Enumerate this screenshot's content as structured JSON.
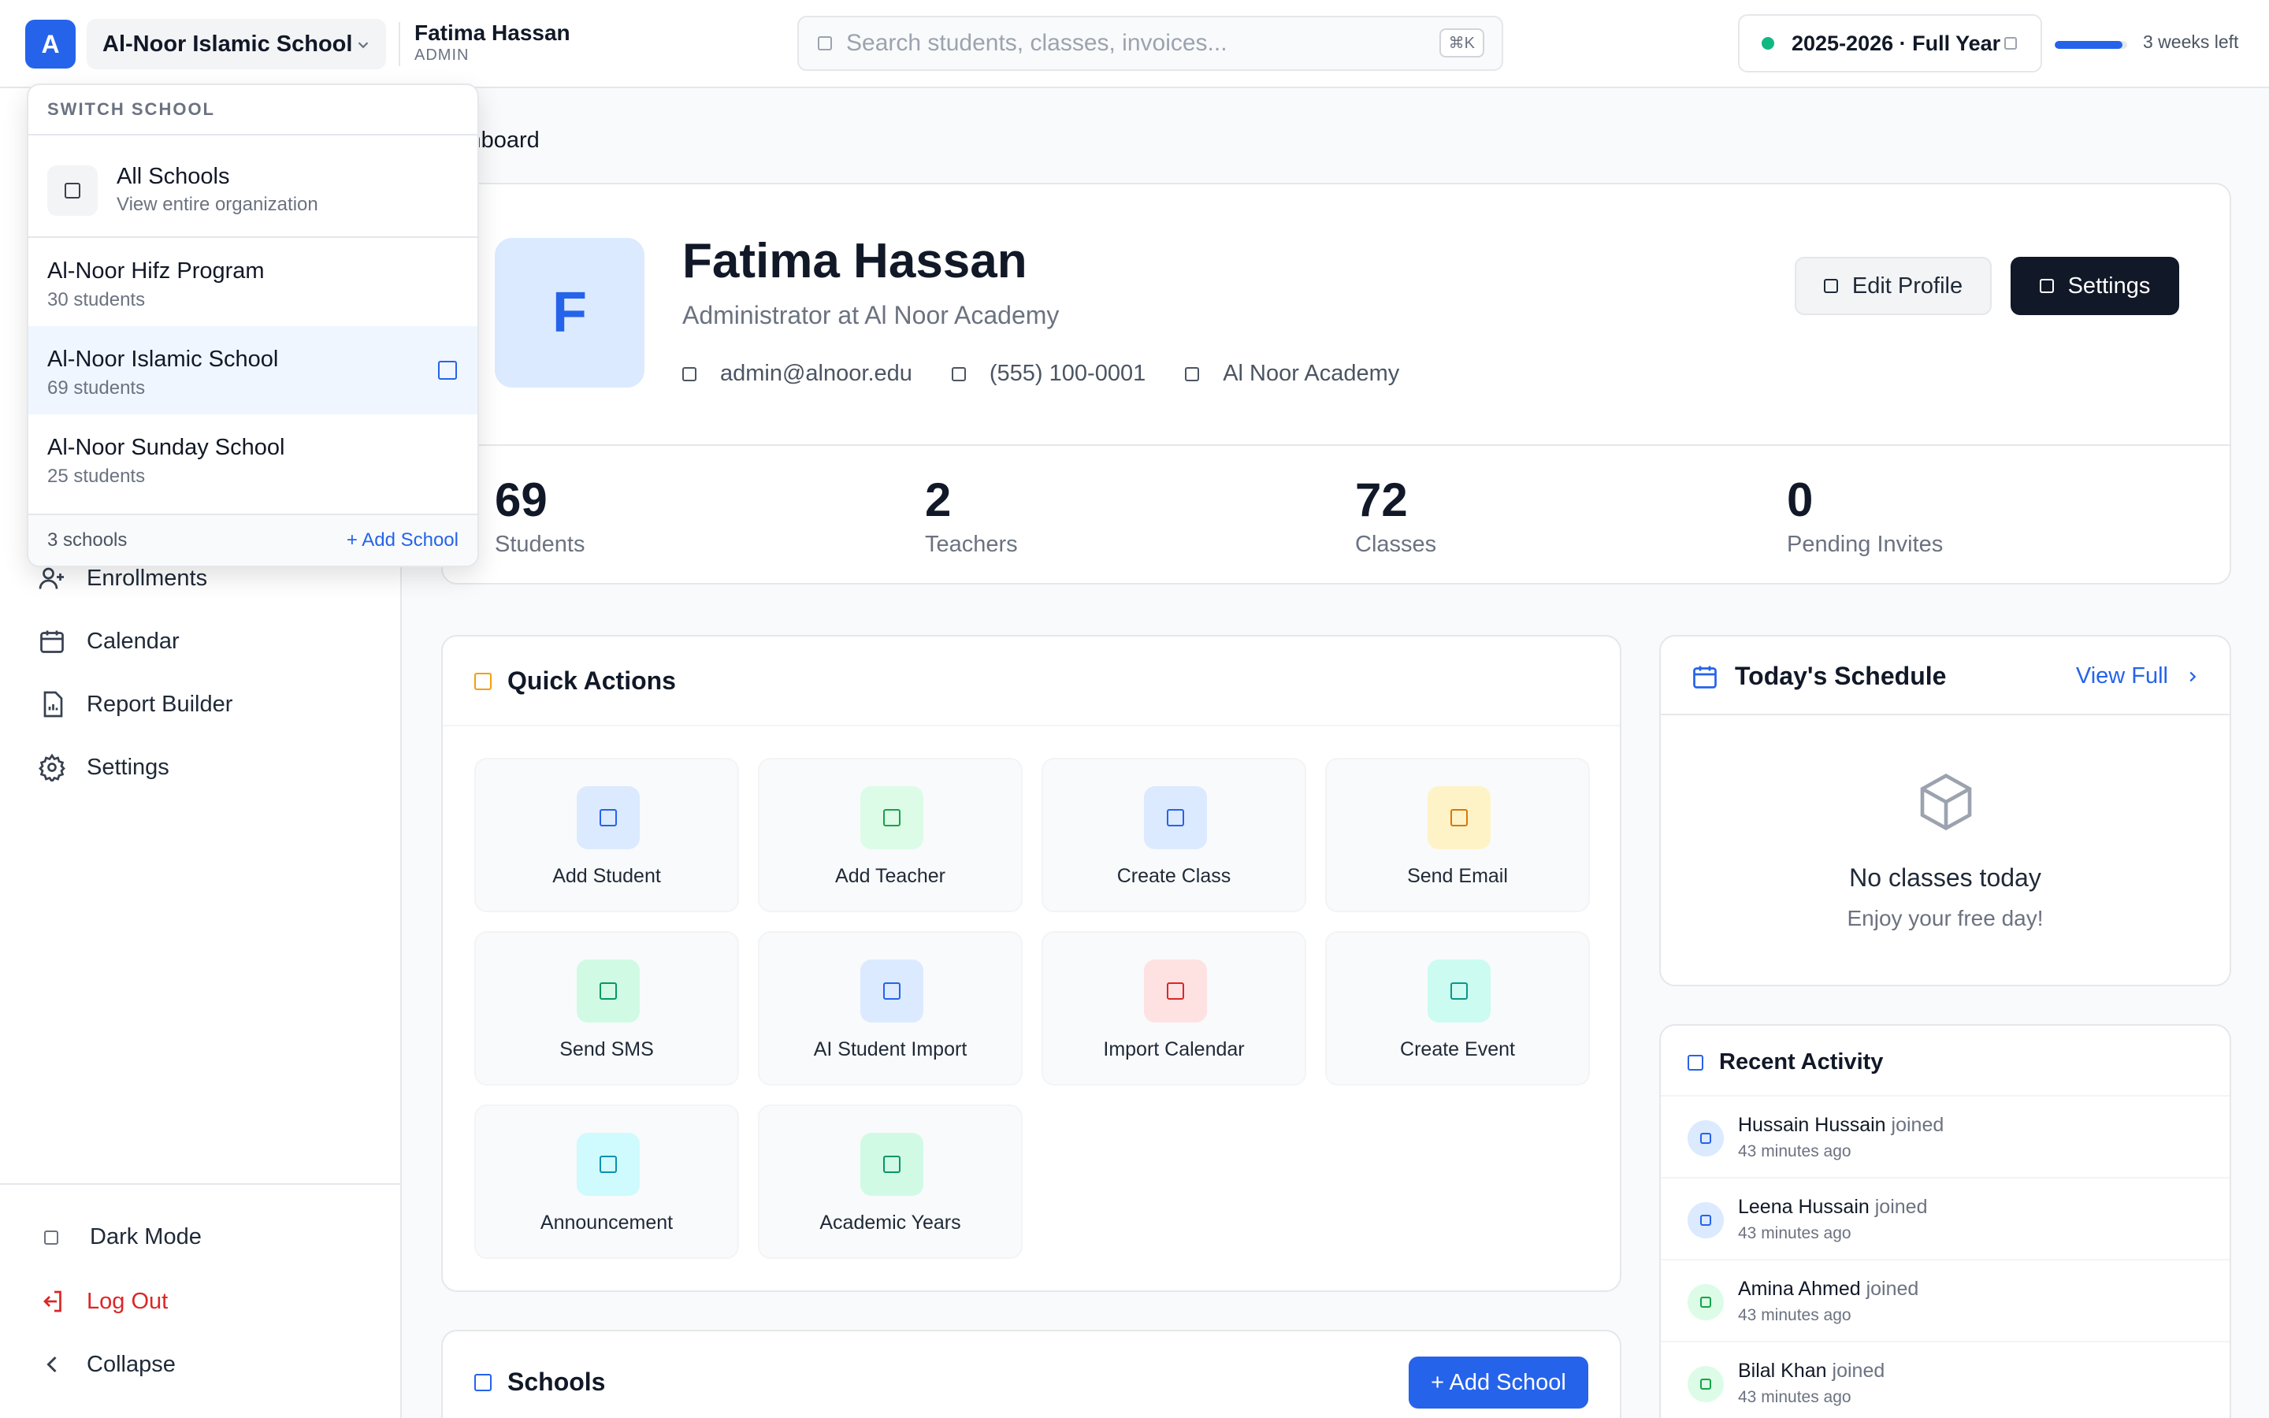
{
  "topbar": {
    "logo_letter": "A",
    "school_selector": "Al-Noor Islamic School",
    "user_name": "Fatima Hassan",
    "user_role": "ADMIN",
    "search_placeholder": "Search students, classes, invoices...",
    "search_shortcut": "⌘K",
    "academic_year": "2025-2026 · Full Year",
    "year_progress_percent": 94,
    "weeks_left": "3 weeks left"
  },
  "dropdown": {
    "header": "SWITCH SCHOOL",
    "all_title": "All Schools",
    "all_sub": "View entire organization",
    "schools": [
      {
        "name": "Al-Noor Hifz Program",
        "count": "30 students"
      },
      {
        "name": "Al-Noor Islamic School",
        "count": "69 students"
      },
      {
        "name": "Al-Noor Sunday School",
        "count": "25 students"
      }
    ],
    "footer_count": "3 schools",
    "footer_add": "+ Add School"
  },
  "sidebar": {
    "items": [
      "Enrollments",
      "Calendar",
      "Report Builder",
      "Settings"
    ],
    "bottom": [
      "Dark Mode",
      "Log Out",
      "Collapse"
    ]
  },
  "breadcrumb": "shboard",
  "profile": {
    "avatar_letter": "F",
    "name": "Fatima Hassan",
    "role": "Administrator at Al Noor Academy",
    "email": "admin@alnoor.edu",
    "phone": "(555) 100-0001",
    "org": "Al Noor Academy",
    "edit_label": "Edit Profile",
    "settings_label": "Settings"
  },
  "stats": [
    {
      "value": "69",
      "label": "Students"
    },
    {
      "value": "2",
      "label": "Teachers"
    },
    {
      "value": "72",
      "label": "Classes"
    },
    {
      "value": "0",
      "label": "Pending Invites"
    }
  ],
  "quick_actions": {
    "title": "Quick Actions",
    "items": [
      {
        "label": "Add Student",
        "bg": "#dbeafe",
        "fg": "#2563eb"
      },
      {
        "label": "Add Teacher",
        "bg": "#dcfce7",
        "fg": "#16a34a"
      },
      {
        "label": "Create Class",
        "bg": "#dbeafe",
        "fg": "#2563eb"
      },
      {
        "label": "Send Email",
        "bg": "#fef3c7",
        "fg": "#d97706"
      },
      {
        "label": "Send SMS",
        "bg": "#d1fae5",
        "fg": "#059669"
      },
      {
        "label": "AI Student Import",
        "bg": "#dbeafe",
        "fg": "#2563eb"
      },
      {
        "label": "Import Calendar",
        "bg": "#fee2e2",
        "fg": "#dc2626"
      },
      {
        "label": "Create Event",
        "bg": "#ccfbf1",
        "fg": "#0d9488"
      },
      {
        "label": "Announcement",
        "bg": "#cffafe",
        "fg": "#0891b2"
      },
      {
        "label": "Academic Years",
        "bg": "#d1fae5",
        "fg": "#059669"
      }
    ]
  },
  "schedule": {
    "title": "Today's Schedule",
    "view_full": "View Full",
    "empty_title": "No classes today",
    "empty_sub": "Enjoy your free day!"
  },
  "activity": {
    "title": "Recent Activity",
    "items": [
      {
        "name": "Hussain Hussain",
        "action": "joined",
        "time": "43 minutes ago",
        "bg": "#dbeafe",
        "fg": "#2563eb"
      },
      {
        "name": "Leena Hussain",
        "action": "joined",
        "time": "43 minutes ago",
        "bg": "#dbeafe",
        "fg": "#2563eb"
      },
      {
        "name": "Amina Ahmed",
        "action": "joined",
        "time": "43 minutes ago",
        "bg": "#dcfce7",
        "fg": "#16a34a"
      },
      {
        "name": "Bilal Khan",
        "action": "joined",
        "time": "43 minutes ago",
        "bg": "#dcfce7",
        "fg": "#16a34a"
      }
    ]
  },
  "schools_section": {
    "title": "Schools",
    "add_label": "+ Add School"
  },
  "colors": {
    "accent": "#2563eb",
    "danger": "#dc2626",
    "dark": "#111827"
  }
}
